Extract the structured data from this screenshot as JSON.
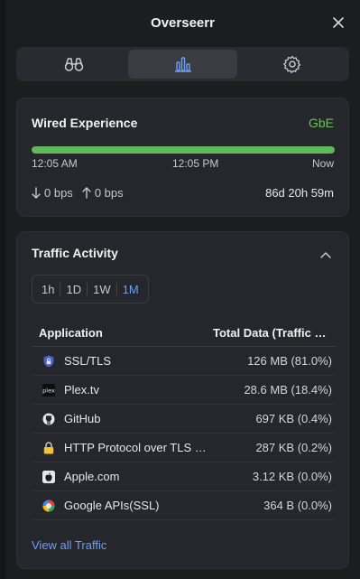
{
  "header": {
    "title": "Overseerr"
  },
  "tabs": [
    {
      "icon": "binoculars-icon"
    },
    {
      "icon": "bar-chart-icon",
      "active": true
    },
    {
      "icon": "gear-icon"
    }
  ],
  "connection": {
    "name": "Wired Experience",
    "speed_badge": "GbE",
    "availability_fraction": 1.0,
    "time_start": "12:05 AM",
    "time_mid": "12:05 PM",
    "time_end": "Now",
    "download": "0 bps",
    "upload": "0 bps",
    "uptime": "86d 20h 59m",
    "colors": {
      "good": "#5fb85a",
      "badge": "#6fbf5b"
    }
  },
  "traffic": {
    "title": "Traffic Activity",
    "ranges": [
      "1h",
      "1D",
      "1W",
      "1M"
    ],
    "selected_range": "1M",
    "columns": {
      "app": "Application",
      "total": "Total Data (Traffic Share)"
    },
    "rows": [
      {
        "icon": "shield-lock-icon",
        "name": "SSL/TLS",
        "value": "126 MB (81.0%)"
      },
      {
        "icon": "plex-icon",
        "name": "Plex.tv",
        "value": "28.6 MB (18.4%)"
      },
      {
        "icon": "github-icon",
        "name": "GitHub",
        "value": "697 KB (0.4%)"
      },
      {
        "icon": "lock-icon",
        "name": "HTTP Protocol over TLS SSL",
        "value": "287 KB (0.2%)"
      },
      {
        "icon": "apple-icon",
        "name": "Apple.com",
        "value": "3.12 KB (0.0%)"
      },
      {
        "icon": "google-icon",
        "name": "Google APIs(SSL)",
        "value": "364 B (0.0%)"
      }
    ],
    "view_all": "View all Traffic",
    "colors": {
      "accent": "#6f9ef3"
    }
  }
}
